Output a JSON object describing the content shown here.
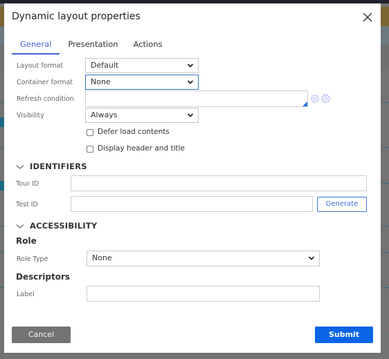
{
  "dialog": {
    "title": "Dynamic layout properties",
    "close_icon": "close-icon"
  },
  "tabs": [
    {
      "label": "General",
      "active": true
    },
    {
      "label": "Presentation",
      "active": false
    },
    {
      "label": "Actions",
      "active": false
    }
  ],
  "general": {
    "layout_format": {
      "label": "Layout format",
      "value": "Default"
    },
    "container_format": {
      "label": "Container format",
      "value": "None"
    },
    "refresh_condition": {
      "label": "Refresh condition",
      "value": ""
    },
    "visibility": {
      "label": "Visibility",
      "value": "Always"
    },
    "defer_load": {
      "label": "Defer load contents",
      "checked": false
    },
    "display_header": {
      "label": "Display header and title",
      "checked": false
    }
  },
  "identifiers": {
    "heading": "IDENTIFIERS",
    "tour_id": {
      "label": "Tour ID",
      "value": ""
    },
    "test_id": {
      "label": "Test ID",
      "value": ""
    },
    "generate_label": "Generate"
  },
  "accessibility": {
    "heading": "ACCESSIBILITY",
    "role_heading": "Role",
    "role_type": {
      "label": "Role Type",
      "value": "None"
    },
    "descriptors_heading": "Descriptors",
    "label_field": {
      "label": "Label",
      "value": ""
    }
  },
  "footer": {
    "cancel_label": "Cancel",
    "submit_label": "Submit"
  },
  "colors": {
    "accent": "#4a63d4",
    "submit": "#0a64e6",
    "cancel": "#737373"
  }
}
